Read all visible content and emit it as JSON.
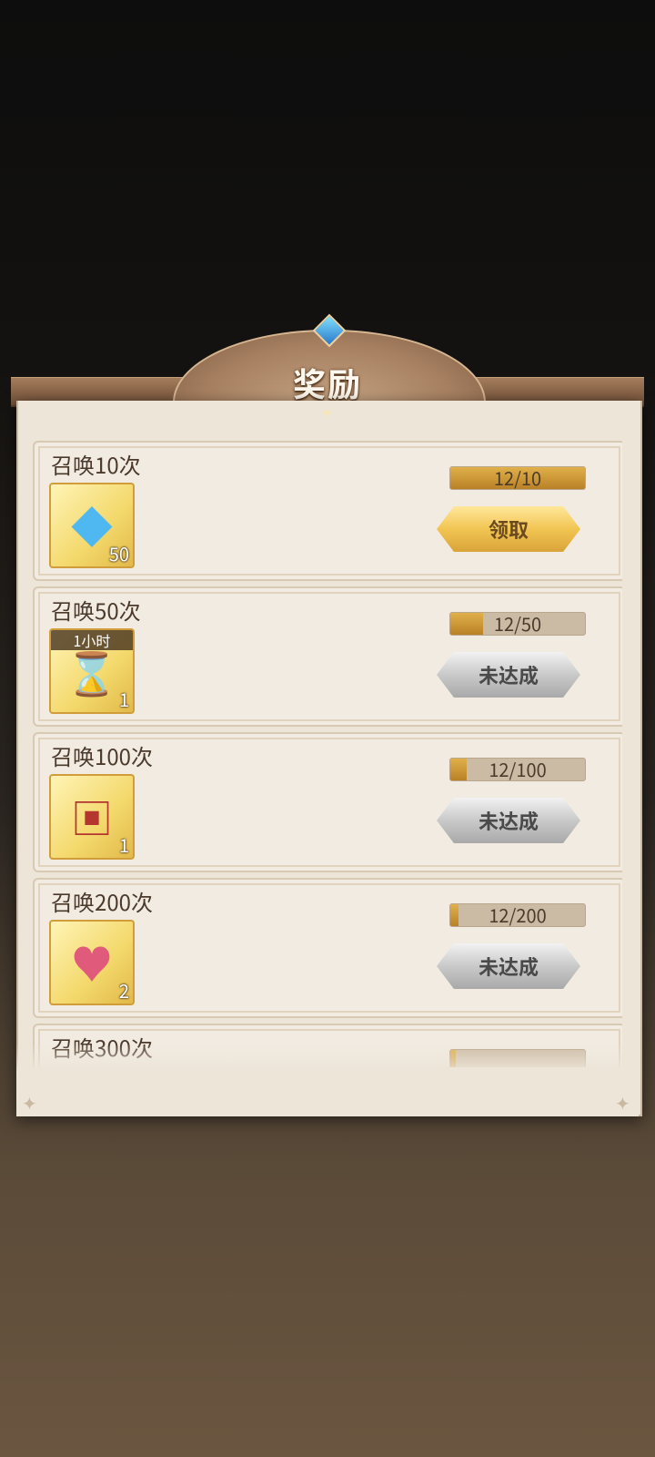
{
  "title": "奖励",
  "rewards": [
    {
      "label": "召唤10次",
      "progress_text": "12/10",
      "progress_fraction": 1.0,
      "item_count": "50",
      "item_icon": "crystal-icon",
      "button": "领取",
      "status": "claimable"
    },
    {
      "label": "召唤50次",
      "progress_text": "12/50",
      "progress_fraction": 0.24,
      "item_count": "1",
      "item_icon": "treasure-pile-icon",
      "item_tag": "1小时",
      "button": "未达成",
      "status": "locked"
    },
    {
      "label": "召唤100次",
      "progress_text": "12/100",
      "progress_fraction": 0.12,
      "item_count": "1",
      "item_icon": "chest-icon",
      "button": "未达成",
      "status": "locked"
    },
    {
      "label": "召唤200次",
      "progress_text": "12/200",
      "progress_fraction": 0.06,
      "item_count": "2",
      "item_icon": "heart-gem-icon",
      "button": "未达成",
      "status": "locked"
    },
    {
      "label": "召唤300次",
      "progress_text": "",
      "progress_fraction": 0.04,
      "status": "locked"
    }
  ],
  "colors": {
    "accent": "#d9a43a",
    "panel": "#ede5d8",
    "text": "#4b3a2c"
  }
}
